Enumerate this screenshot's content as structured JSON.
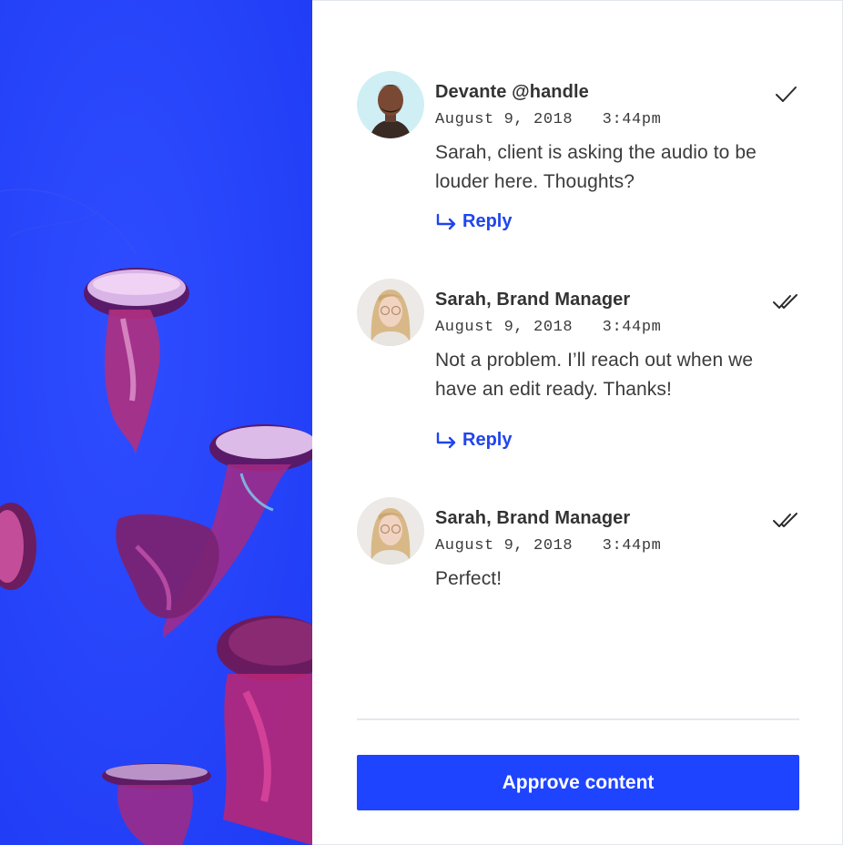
{
  "media": {
    "image": "jellyfish-photo"
  },
  "comments": [
    {
      "author": "Devante @handle",
      "date": "August 9, 2018",
      "time": "3:44pm",
      "text": "Sarah, client is asking the audio to be louder here. Thoughts?",
      "status_icon": "check-icon",
      "reply_label": "Reply",
      "avatar": "devante-avatar"
    },
    {
      "author": "Sarah, Brand Manager",
      "date": "August 9, 2018",
      "time": "3:44pm",
      "text": "Not a problem. I’ll reach out when we have an edit ready. Thanks!",
      "status_icon": "double-check-icon",
      "reply_label": "Reply",
      "avatar": "sarah-avatar"
    },
    {
      "author": "Sarah, Brand Manager",
      "date": "August 9, 2018",
      "time": "3:44pm",
      "text": "Perfect!",
      "status_icon": "double-check-icon",
      "avatar": "sarah-avatar"
    }
  ],
  "actions": {
    "approve_label": "Approve content"
  },
  "colors": {
    "accent": "#1f44ff",
    "media_background": "#2244ff",
    "text": "#333333",
    "divider": "#e6e8ee"
  }
}
